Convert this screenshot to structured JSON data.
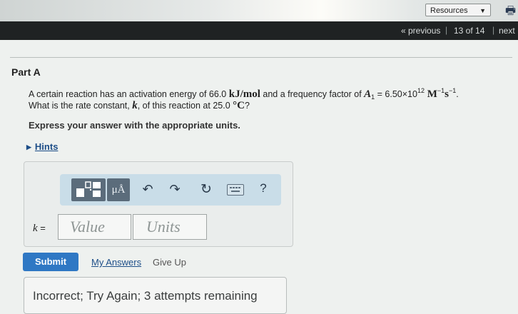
{
  "header": {
    "resources_label": "Resources",
    "dropdown_caret": "▼",
    "printer_icon": "🖶"
  },
  "navigation": {
    "previous": "« previous",
    "separator": "|",
    "count": "13 of 14",
    "next": "next"
  },
  "part": {
    "title": "Part A"
  },
  "question": {
    "line1_text": "A certain reaction has an activation energy of 66.0 ",
    "activation_energy_units": "kJ/mol",
    "line1_mid": " and a frequency factor of ",
    "frequency_symbol": "A",
    "frequency_subscript": "1",
    "frequency_value": " = 6.50×10",
    "frequency_exponent": "12",
    "frequency_unit_m": " M",
    "frequency_unit_m_exp": "−1",
    "frequency_unit_s": "s",
    "frequency_unit_s_exp": "−1",
    "line1_end": ".",
    "line2_text": "What is the rate constant, ",
    "rate_symbol": "k",
    "line2_mid": ", of this reaction at 25.0 ",
    "temperature_unit": "°C",
    "line2_end": "?"
  },
  "instructions": "Express your answer with the appropriate units.",
  "hints": {
    "arrow": "▶",
    "label": "Hints"
  },
  "toolbar": {
    "units_button_label": "μÅ",
    "undo_icon": "↶",
    "redo_icon": "↷",
    "reset_icon": "↻",
    "help_label": "?"
  },
  "answer": {
    "variable_label": "k",
    "equals": " =",
    "value_placeholder": "Value",
    "units_placeholder": "Units"
  },
  "actions": {
    "submit": "Submit",
    "my_answers": "My Answers",
    "give_up": "Give Up"
  },
  "feedback": "Incorrect; Try Again; 3 attempts remaining",
  "colors": {
    "submit_blue": "#2f78c4",
    "link_blue": "#1d4e88",
    "toolbar_bg": "#c9dde8",
    "navbar_bg": "#1f2223"
  }
}
